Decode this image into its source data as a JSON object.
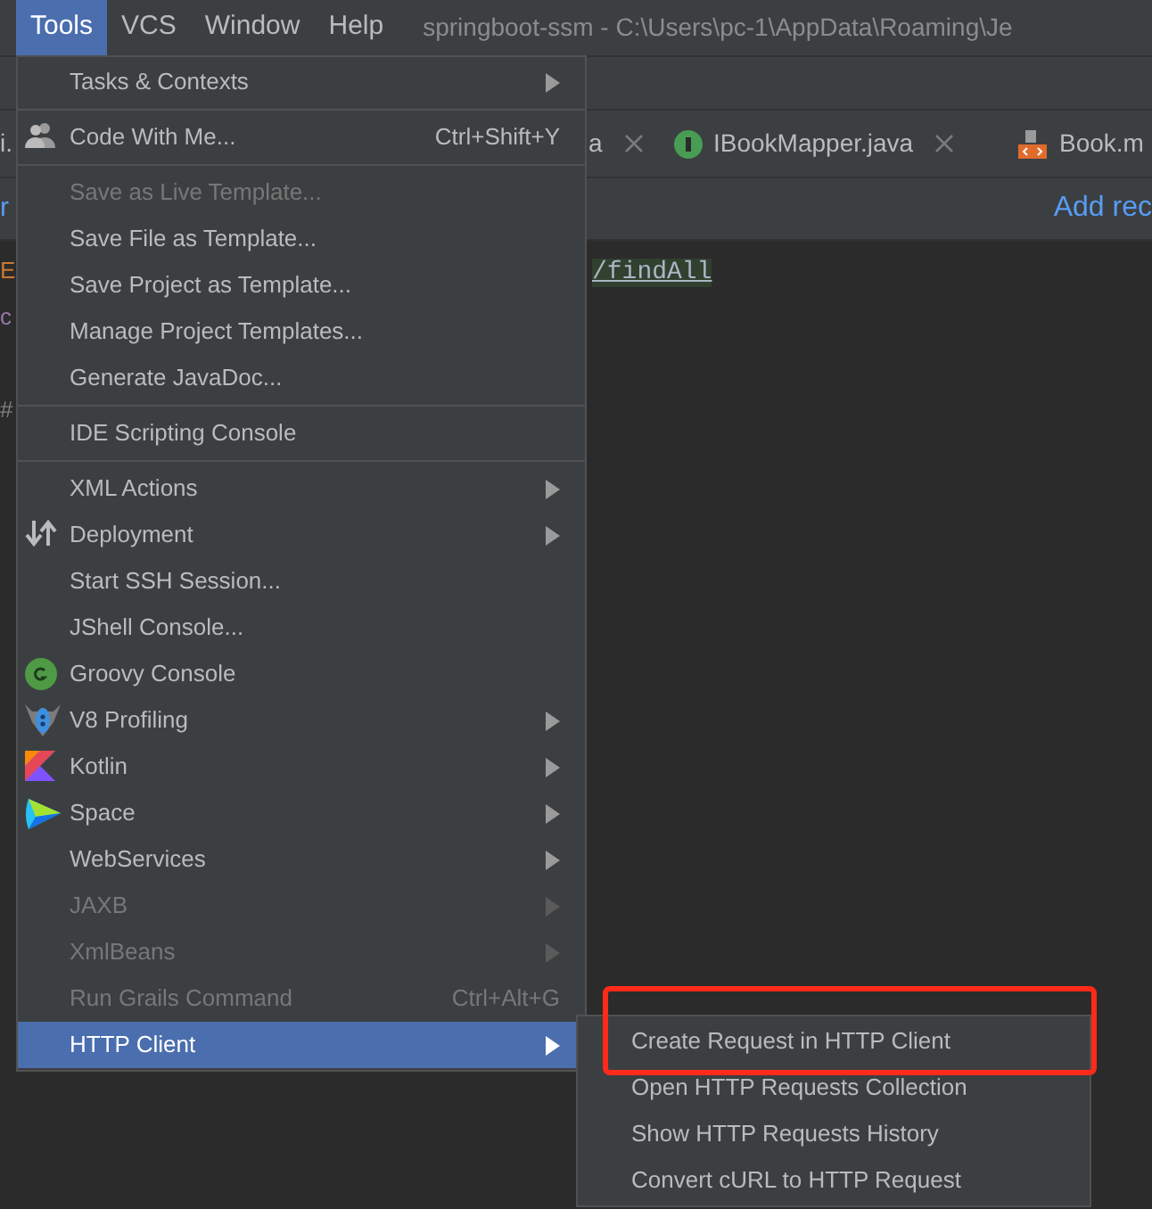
{
  "menu_bar": [
    {
      "label": "Tools",
      "selected": true
    },
    {
      "label": "VCS",
      "selected": false
    },
    {
      "label": "Window",
      "selected": false
    },
    {
      "label": "Help",
      "selected": false
    }
  ],
  "window_title": "springboot-ssm - C:\\Users\\pc-1\\AppData\\Roaming\\Je",
  "editor_tabs": [
    {
      "label": "i.",
      "close": false
    },
    {
      "label": "a",
      "close": true
    },
    {
      "label": "IBookMapper.java",
      "close": true
    },
    {
      "label": "Book.m",
      "close": false
    }
  ],
  "toolbar_fragment": "r",
  "add_link": "Add rec",
  "gutter_fragments": [
    "E",
    "c",
    "#"
  ],
  "code_line": "/findAll",
  "tools_menu": [
    {
      "label": "Tasks & Contexts",
      "submenu": true,
      "disabled": false,
      "selected": false,
      "separator_after": true
    },
    {
      "label": "Code With Me...",
      "shortcut": "Ctrl+Shift+Y",
      "submenu": false,
      "disabled": false,
      "selected": false,
      "separator_after": true
    },
    {
      "label": "Save as Live Template...",
      "submenu": false,
      "disabled": true,
      "selected": false,
      "separator_after": false
    },
    {
      "label": "Save File as Template...",
      "submenu": false,
      "disabled": false,
      "selected": false,
      "separator_after": false
    },
    {
      "label": "Save Project as Template...",
      "submenu": false,
      "disabled": false,
      "selected": false,
      "separator_after": false
    },
    {
      "label": "Manage Project Templates...",
      "submenu": false,
      "disabled": false,
      "selected": false,
      "separator_after": false
    },
    {
      "label": "Generate JavaDoc...",
      "submenu": false,
      "disabled": false,
      "selected": false,
      "separator_after": true
    },
    {
      "label": "IDE Scripting Console",
      "submenu": false,
      "disabled": false,
      "selected": false,
      "separator_after": true
    },
    {
      "label": "XML Actions",
      "submenu": true,
      "disabled": false,
      "selected": false,
      "separator_after": false
    },
    {
      "label": "Deployment",
      "submenu": true,
      "disabled": false,
      "selected": false,
      "separator_after": false
    },
    {
      "label": "Start SSH Session...",
      "submenu": false,
      "disabled": false,
      "selected": false,
      "separator_after": false
    },
    {
      "label": "JShell Console...",
      "submenu": false,
      "disabled": false,
      "selected": false,
      "separator_after": false
    },
    {
      "label": "Groovy Console",
      "submenu": false,
      "disabled": false,
      "selected": false,
      "separator_after": false
    },
    {
      "label": "V8 Profiling",
      "submenu": true,
      "disabled": false,
      "selected": false,
      "separator_after": false
    },
    {
      "label": "Kotlin",
      "submenu": true,
      "disabled": false,
      "selected": false,
      "separator_after": false
    },
    {
      "label": "Space",
      "submenu": true,
      "disabled": false,
      "selected": false,
      "separator_after": false
    },
    {
      "label": "WebServices",
      "submenu": true,
      "disabled": false,
      "selected": false,
      "separator_after": false
    },
    {
      "label": "JAXB",
      "submenu": true,
      "disabled": true,
      "selected": false,
      "separator_after": false
    },
    {
      "label": "XmlBeans",
      "submenu": true,
      "disabled": true,
      "selected": false,
      "separator_after": false
    },
    {
      "label": "Run Grails Command",
      "shortcut": "Ctrl+Alt+G",
      "submenu": false,
      "disabled": true,
      "selected": false,
      "separator_after": false
    },
    {
      "label": "HTTP Client",
      "submenu": true,
      "disabled": false,
      "selected": true,
      "separator_after": false
    }
  ],
  "http_client_submenu": [
    {
      "label": "Create Request in HTTP Client",
      "annotated": true
    },
    {
      "label": "Open HTTP Requests Collection",
      "annotated": false
    },
    {
      "label": "Show HTTP Requests History",
      "annotated": false
    },
    {
      "label": "Convert cURL to HTTP Request",
      "annotated": false
    }
  ]
}
